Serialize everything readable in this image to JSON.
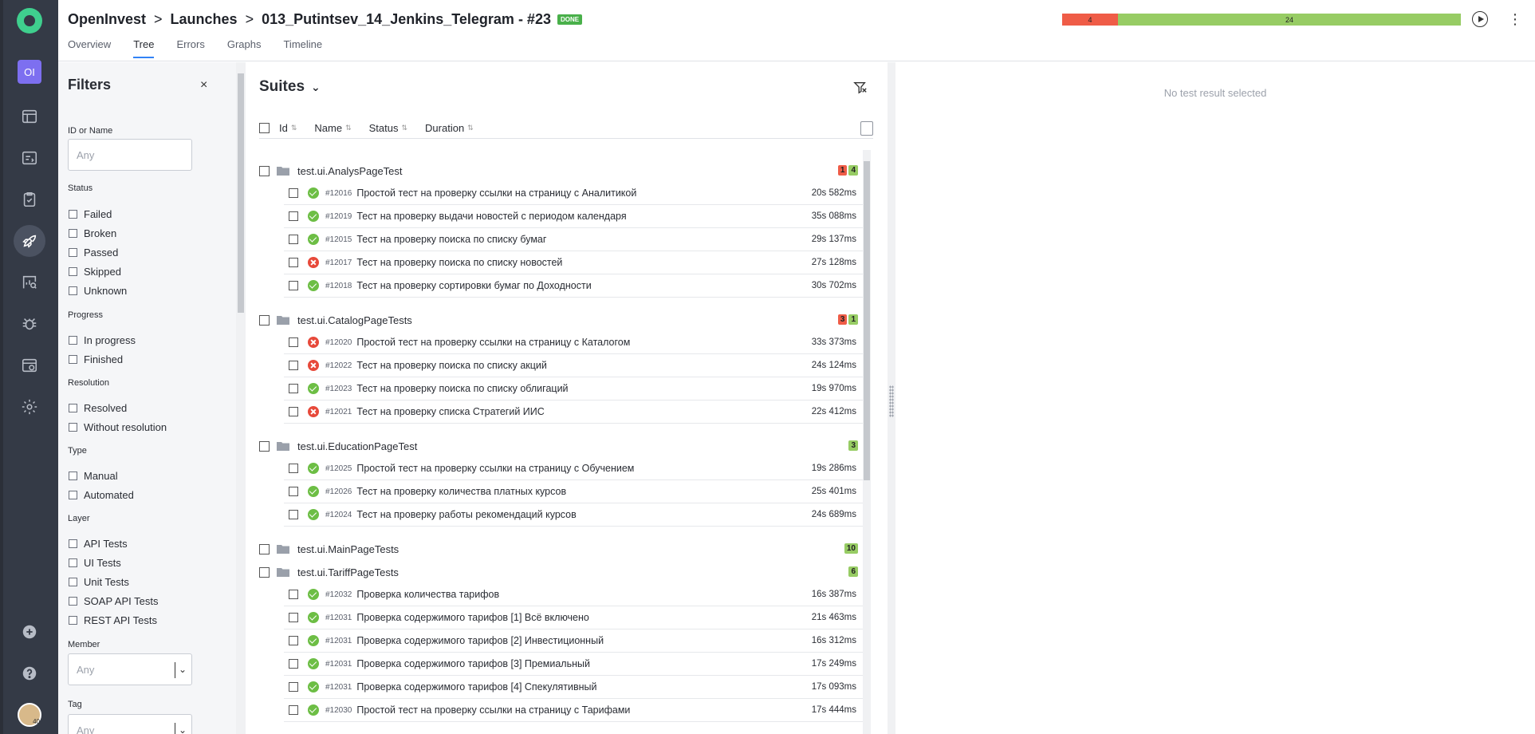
{
  "breadcrumb": {
    "project": "OpenInvest",
    "section": "Launches",
    "launch": "013_Putintsev_14_Jenkins_Telegram - #23",
    "status_badge": "DONE"
  },
  "tabs": [
    {
      "label": "Overview",
      "active": false
    },
    {
      "label": "Tree",
      "active": true
    },
    {
      "label": "Errors",
      "active": false
    },
    {
      "label": "Graphs",
      "active": false
    },
    {
      "label": "Timeline",
      "active": false
    }
  ],
  "summary_bar": {
    "failed": "4",
    "passed": "24",
    "failed_share": 0.14,
    "passed_share": 0.86
  },
  "sidebar": {
    "project_initials": "OI",
    "avatar_text": "40",
    "icons": [
      "logo-icon",
      "dashboard-icon",
      "testcases-icon",
      "testplans-icon",
      "launches-icon",
      "analytics-icon",
      "defects-icon",
      "jobs-icon",
      "settings-icon",
      "add-icon",
      "help-icon"
    ]
  },
  "filters": {
    "title": "Filters",
    "close": "×",
    "id_label": "ID or Name",
    "id_placeholder": "Any",
    "status_label": "Status",
    "status_options": [
      "Failed",
      "Broken",
      "Passed",
      "Skipped",
      "Unknown"
    ],
    "progress_label": "Progress",
    "progress_options": [
      "In progress",
      "Finished"
    ],
    "resolution_label": "Resolution",
    "resolution_options": [
      "Resolved",
      "Without resolution"
    ],
    "type_label": "Type",
    "type_options": [
      "Manual",
      "Automated"
    ],
    "layer_label": "Layer",
    "layer_options": [
      "API Tests",
      "UI Tests",
      "Unit Tests",
      "SOAP API Tests",
      "REST API Tests"
    ],
    "member_label": "Member",
    "member_value": "Any",
    "tag_label": "Tag",
    "tag_value": "Any"
  },
  "suites": {
    "title": "Suites",
    "columns": [
      "Id",
      "Name",
      "Status",
      "Duration"
    ],
    "groups": [
      {
        "name": "test.ui.AnalysPageTest",
        "failed": "1",
        "passed": "4",
        "tests": [
          {
            "id": "#12016",
            "name": "Простой тест на проверку ссылки на страницу с Аналитикой",
            "status": "passed",
            "duration": "20s 582ms"
          },
          {
            "id": "#12019",
            "name": "Тест на проверку выдачи новостей с периодом календаря",
            "status": "passed",
            "duration": "35s 088ms"
          },
          {
            "id": "#12015",
            "name": "Тест на проверку поиска по списку бумаг",
            "status": "passed",
            "duration": "29s 137ms"
          },
          {
            "id": "#12017",
            "name": "Тест на проверку поиска по списку новостей",
            "status": "failed",
            "duration": "27s 128ms"
          },
          {
            "id": "#12018",
            "name": "Тест на проверку сортировки бумаг по Доходности",
            "status": "passed",
            "duration": "30s 702ms"
          }
        ]
      },
      {
        "name": "test.ui.CatalogPageTests",
        "failed": "3",
        "passed": "1",
        "tests": [
          {
            "id": "#12020",
            "name": "Простой тест на проверку ссылки на страницу с Каталогом",
            "status": "failed",
            "duration": "33s 373ms"
          },
          {
            "id": "#12022",
            "name": "Тест на проверку поиска по списку акций",
            "status": "failed",
            "duration": "24s 124ms"
          },
          {
            "id": "#12023",
            "name": "Тест на проверку поиска по списку облигаций",
            "status": "passed",
            "duration": "19s 970ms"
          },
          {
            "id": "#12021",
            "name": "Тест на проверку списка Стратегий ИИС",
            "status": "failed",
            "duration": "22s 412ms"
          }
        ]
      },
      {
        "name": "test.ui.EducationPageTest",
        "failed": "",
        "passed": "3",
        "tests": [
          {
            "id": "#12025",
            "name": "Простой тест на проверку ссылки на страницу с Обучением",
            "status": "passed",
            "duration": "19s 286ms"
          },
          {
            "id": "#12026",
            "name": "Тест на проверку количества платных курсов",
            "status": "passed",
            "duration": "25s 401ms"
          },
          {
            "id": "#12024",
            "name": "Тест на проверку работы рекомендаций курсов",
            "status": "passed",
            "duration": "24s 689ms"
          }
        ]
      },
      {
        "name": "test.ui.MainPageTests",
        "failed": "",
        "passed": "10",
        "tests": []
      },
      {
        "name": "test.ui.TariffPageTests",
        "failed": "",
        "passed": "6",
        "tests": [
          {
            "id": "#12032",
            "name": "Проверка количества тарифов",
            "status": "passed",
            "duration": "16s 387ms"
          },
          {
            "id": "#12031",
            "name": "Проверка содержимого тарифов [1] Всё включено",
            "status": "passed",
            "duration": "21s 463ms"
          },
          {
            "id": "#12031",
            "name": "Проверка содержимого тарифов [2] Инвестиционный",
            "status": "passed",
            "duration": "16s 312ms"
          },
          {
            "id": "#12031",
            "name": "Проверка содержимого тарифов [3] Премиальный",
            "status": "passed",
            "duration": "17s 249ms"
          },
          {
            "id": "#12031",
            "name": "Проверка содержимого тарифов [4] Спекулятивный",
            "status": "passed",
            "duration": "17s 093ms"
          },
          {
            "id": "#12030",
            "name": "Простой тест на проверку ссылки на страницу с Тарифами",
            "status": "passed",
            "duration": "17s 444ms"
          }
        ]
      }
    ]
  },
  "details": {
    "empty_text": "No test result selected"
  },
  "colors": {
    "failed": "#ef5c47",
    "passed": "#97cc64",
    "accent": "#3182f6",
    "rail": "#343a46"
  }
}
